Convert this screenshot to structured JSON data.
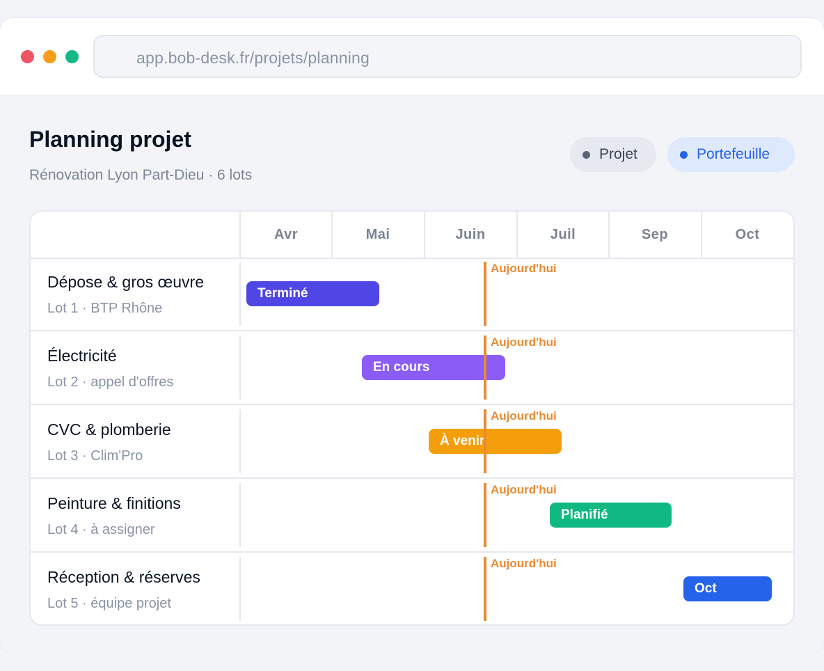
{
  "browser": {
    "url": "app.bob-desk.fr/projets/planning",
    "traffic_lights": [
      "close",
      "minimize",
      "maximize"
    ]
  },
  "page": {
    "title": "Planning projet",
    "subtitle": "Rénovation Lyon Part-Dieu · 6 lots"
  },
  "view_toggle": {
    "options": [
      {
        "label": "Projet",
        "active": false
      },
      {
        "label": "Portefeuille",
        "active": true
      }
    ]
  },
  "gantt": {
    "months": [
      "Avr",
      "Mai",
      "Juin",
      "Juil",
      "Sep",
      "Oct"
    ],
    "today_label": "Aujourd'hui",
    "rows": [
      {
        "name": "Dépose & gros œuvre",
        "sub": "Lot 1 · BTP Rhône",
        "bar_label": "Terminé",
        "bar_color": "#4f46e5"
      },
      {
        "name": "Électricité",
        "sub": "Lot 2 · appel d'offres",
        "bar_label": "En cours",
        "bar_color": "#8b5cf6"
      },
      {
        "name": "CVC & plomberie",
        "sub": "Lot 3 · Clim'Pro",
        "bar_label": "À venir",
        "bar_color": "#f59e0b"
      },
      {
        "name": "Peinture & finitions",
        "sub": "Lot 4 · à assigner",
        "bar_label": "Planifié",
        "bar_color": "#10b981"
      },
      {
        "name": "Réception & réserves",
        "sub": "Lot 5 · équipe projet",
        "bar_label": "Oct",
        "bar_color": "#2563eb"
      }
    ]
  },
  "colors": {
    "today": "#ea8a33",
    "accent": "#2563eb"
  }
}
